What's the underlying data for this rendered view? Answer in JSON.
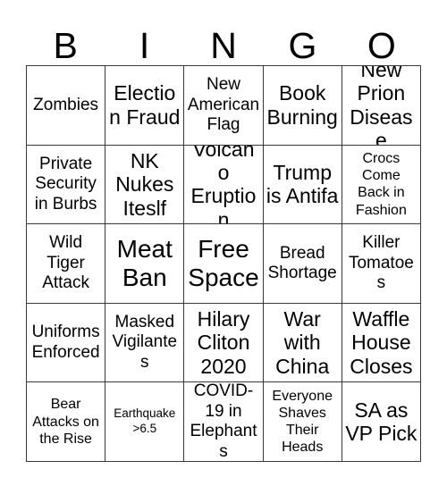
{
  "card": {
    "title": "BINGO",
    "header_letters": [
      "B",
      "I",
      "N",
      "G",
      "O"
    ],
    "rows": [
      [
        {
          "text": "Zombies",
          "size": "md"
        },
        {
          "text": "Election Fraud",
          "size": "lg"
        },
        {
          "text": "New American Flag",
          "size": "md"
        },
        {
          "text": "Book Burning",
          "size": "lg"
        },
        {
          "text": "New Prion Disease",
          "size": "lg"
        }
      ],
      [
        {
          "text": "Private Security in Burbs",
          "size": "md"
        },
        {
          "text": "NK Nukes Iteslf",
          "size": "lg"
        },
        {
          "text": "Volcano Eruption",
          "size": "lg"
        },
        {
          "text": "Trump is Antifa",
          "size": "lg"
        },
        {
          "text": "Crocs Come Back in Fashion",
          "size": "sm"
        }
      ],
      [
        {
          "text": "Wild Tiger Attack",
          "size": "md"
        },
        {
          "text": "Meat Ban",
          "size": "xl"
        },
        {
          "text": "Free Space",
          "size": "xl"
        },
        {
          "text": "Bread Shortage",
          "size": "md"
        },
        {
          "text": "Killer Tomatoes",
          "size": "md"
        }
      ],
      [
        {
          "text": "Uniforms Enforced",
          "size": "md"
        },
        {
          "text": "Masked Vigilantes",
          "size": "md"
        },
        {
          "text": "Hilary Cliton 2020",
          "size": "lg"
        },
        {
          "text": "War with China",
          "size": "lg"
        },
        {
          "text": "Waffle House Closes",
          "size": "lg"
        }
      ],
      [
        {
          "text": "Bear Attacks on the Rise",
          "size": "sm"
        },
        {
          "text": "Earthquake >6.5",
          "size": "xs"
        },
        {
          "text": "COVID-19 in Elephants",
          "size": "md"
        },
        {
          "text": "Everyone Shaves Their Heads",
          "size": "sm"
        },
        {
          "text": "SA as VP Pick",
          "size": "lg"
        }
      ]
    ]
  },
  "colors": {
    "background": "#ffffff",
    "text": "#000000",
    "grid_line": "#3a3a3a"
  }
}
